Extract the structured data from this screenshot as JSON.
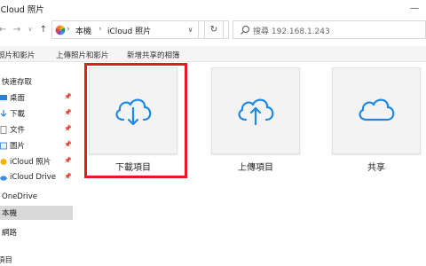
{
  "window": {
    "title": "iCloud 照片",
    "minimize_glyph": "—"
  },
  "navigation": {
    "back_glyph": "←",
    "forward_glyph": "→",
    "recent_glyph": "∨",
    "up_glyph": "↑",
    "breadcrumbs": [
      "本機",
      "iCloud 照片"
    ],
    "separator": "›",
    "dropdown_glyph": "∨",
    "refresh_glyph": "↻",
    "search_placeholder": "搜尋 192.168.1.243"
  },
  "commands": [
    "照片和影片",
    "上傳照片和影片",
    "新增共享的相簿"
  ],
  "sidebar": {
    "items": [
      {
        "label": "快速存取",
        "icon": "star-icon",
        "pinned": false
      },
      {
        "label": "桌面",
        "icon": "desktop-icon",
        "pinned": true
      },
      {
        "label": "下載",
        "icon": "download-icon",
        "pinned": true
      },
      {
        "label": "文件",
        "icon": "document-icon",
        "pinned": true
      },
      {
        "label": "圖片",
        "icon": "picture-icon",
        "pinned": true
      },
      {
        "label": "iCloud 照片",
        "icon": "icloud-photos-icon",
        "pinned": true
      },
      {
        "label": "iCloud Drive",
        "icon": "icloud-drive-icon",
        "pinned": true
      },
      {
        "label": "OneDrive",
        "icon": "onedrive-icon",
        "pinned": false
      },
      {
        "label": "本機",
        "icon": "this-pc-icon",
        "pinned": false,
        "selected": true
      },
      {
        "label": "網路",
        "icon": "network-icon",
        "pinned": false
      }
    ],
    "pin_glyph": "📌"
  },
  "tiles": [
    {
      "label": "下載項目",
      "icon": "cloud-download-icon",
      "highlighted": true
    },
    {
      "label": "上傳項目",
      "icon": "cloud-upload-icon",
      "highlighted": false
    },
    {
      "label": "共享",
      "icon": "cloud-icon",
      "highlighted": false
    }
  ],
  "status": {
    "text": "項目"
  },
  "colors": {
    "accent": "#1e88e5",
    "highlight": "#e01b24",
    "tile_bg": "#f3f3f3"
  }
}
